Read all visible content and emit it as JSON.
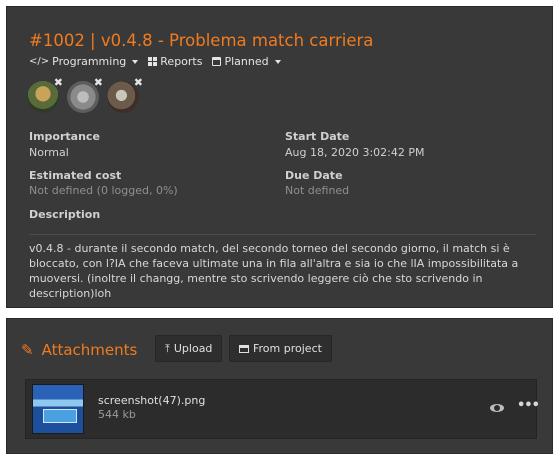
{
  "issue": {
    "title": "#1002 | v0.4.8 - Problema match carriera"
  },
  "toolbar": {
    "programming_label": "Programming",
    "reports_label": "Reports",
    "planned_label": "Planned"
  },
  "assignees": [
    {
      "remove_label": "✖"
    },
    {
      "remove_label": "✖"
    },
    {
      "remove_label": "✖"
    }
  ],
  "fields": {
    "importance": {
      "label": "Importance",
      "value": "Normal"
    },
    "start_date": {
      "label": "Start Date",
      "value": "Aug 18, 2020 3:02:42 PM"
    },
    "estimated_cost": {
      "label": "Estimated cost",
      "value": "Not defined (0 logged, 0%)"
    },
    "due_date": {
      "label": "Due Date",
      "value": "Not defined"
    },
    "description": {
      "label": "Description",
      "value": "v0.4.8 - durante il secondo match, del secondo torneo del secondo giorno, il match si è bloccato, con l?IA che faceva ultimate una in fila all'altra e sia io che lIA impossibilitata a muoversi. (inoltre il changg, mentre sto scrivendo leggere ciò che sto scrivendo in description)loh"
    }
  },
  "attachments": {
    "title": "Attachments",
    "upload_label": "Upload",
    "from_project_label": "From project",
    "files": [
      {
        "name": "screenshot(47).png",
        "size": "544 kb",
        "more_label": "•••"
      }
    ]
  },
  "colors": {
    "accent": "#f07b1f",
    "panel": "#393939",
    "card": "#2c2c2c"
  }
}
